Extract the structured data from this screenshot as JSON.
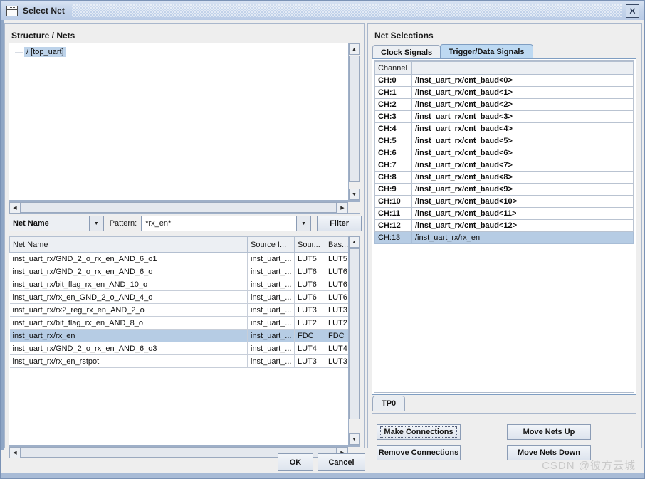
{
  "window": {
    "title": "Select Net",
    "icon": "window-icon",
    "close_label": "✕"
  },
  "left": {
    "header": "Structure / Nets",
    "tree": {
      "node_prefix": "—",
      "node_label": "/ [top_uart]"
    },
    "filter": {
      "field_select": "Net Name",
      "pattern_label": "Pattern:",
      "pattern_value": "*rx_en*",
      "filter_button": "Filter",
      "dropdown_icon": "chevron-down-icon"
    },
    "table": {
      "columns": [
        "Net Name",
        "Source I...",
        "Sour...",
        "Bas..."
      ],
      "rows": [
        {
          "net": "inst_uart_rx/GND_2_o_rx_en_AND_6_o1",
          "source_inst": "inst_uart_...",
          "source": "LUT5",
          "base": "LUT5",
          "selected": false
        },
        {
          "net": "inst_uart_rx/GND_2_o_rx_en_AND_6_o",
          "source_inst": "inst_uart_...",
          "source": "LUT6",
          "base": "LUT6",
          "selected": false
        },
        {
          "net": "inst_uart_rx/bit_flag_rx_en_AND_10_o",
          "source_inst": "inst_uart_...",
          "source": "LUT6",
          "base": "LUT6",
          "selected": false
        },
        {
          "net": "inst_uart_rx/rx_en_GND_2_o_AND_4_o",
          "source_inst": "inst_uart_...",
          "source": "LUT6",
          "base": "LUT6",
          "selected": false
        },
        {
          "net": "inst_uart_rx/rx2_reg_rx_en_AND_2_o",
          "source_inst": "inst_uart_...",
          "source": "LUT3",
          "base": "LUT3",
          "selected": false
        },
        {
          "net": "inst_uart_rx/bit_flag_rx_en_AND_8_o",
          "source_inst": "inst_uart_...",
          "source": "LUT2",
          "base": "LUT2",
          "selected": false
        },
        {
          "net": "inst_uart_rx/rx_en",
          "source_inst": "inst_uart_...",
          "source": "FDC",
          "base": "FDC",
          "selected": true
        },
        {
          "net": "inst_uart_rx/GND_2_o_rx_en_AND_6_o3",
          "source_inst": "inst_uart_...",
          "source": "LUT4",
          "base": "LUT4",
          "selected": false
        },
        {
          "net": "inst_uart_rx/rx_en_rstpot",
          "source_inst": "inst_uart_...",
          "source": "LUT3",
          "base": "LUT3",
          "selected": false
        }
      ]
    }
  },
  "right": {
    "header": "Net Selections",
    "tabs": [
      {
        "label": "Clock Signals",
        "active": false
      },
      {
        "label": "Trigger/Data Signals",
        "active": true
      }
    ],
    "channel_table": {
      "columns": [
        "Channel",
        ""
      ],
      "rows": [
        {
          "channel": "CH:0",
          "net": "/inst_uart_rx/cnt_baud<0>",
          "selected": false
        },
        {
          "channel": "CH:1",
          "net": "/inst_uart_rx/cnt_baud<1>",
          "selected": false
        },
        {
          "channel": "CH:2",
          "net": "/inst_uart_rx/cnt_baud<2>",
          "selected": false
        },
        {
          "channel": "CH:3",
          "net": "/inst_uart_rx/cnt_baud<3>",
          "selected": false
        },
        {
          "channel": "CH:4",
          "net": "/inst_uart_rx/cnt_baud<4>",
          "selected": false
        },
        {
          "channel": "CH:5",
          "net": "/inst_uart_rx/cnt_baud<5>",
          "selected": false
        },
        {
          "channel": "CH:6",
          "net": "/inst_uart_rx/cnt_baud<6>",
          "selected": false
        },
        {
          "channel": "CH:7",
          "net": "/inst_uart_rx/cnt_baud<7>",
          "selected": false
        },
        {
          "channel": "CH:8",
          "net": "/inst_uart_rx/cnt_baud<8>",
          "selected": false
        },
        {
          "channel": "CH:9",
          "net": "/inst_uart_rx/cnt_baud<9>",
          "selected": false
        },
        {
          "channel": "CH:10",
          "net": "/inst_uart_rx/cnt_baud<10>",
          "selected": false
        },
        {
          "channel": "CH:11",
          "net": "/inst_uart_rx/cnt_baud<11>",
          "selected": false
        },
        {
          "channel": "CH:12",
          "net": "/inst_uart_rx/cnt_baud<12>",
          "selected": false
        },
        {
          "channel": "CH:13",
          "net": "/inst_uart_rx/rx_en",
          "selected": true
        }
      ]
    },
    "unit_tabs": [
      {
        "label": "TP0",
        "active": true
      }
    ],
    "actions": {
      "make_connections": "Make Connections",
      "remove_connections": "Remove Connections",
      "move_nets_up": "Move Nets Up",
      "move_nets_down": "Move Nets Down"
    }
  },
  "footer": {
    "ok": "OK",
    "cancel": "Cancel",
    "watermark": "CSDN @彼方云城"
  },
  "colors": {
    "selection": "#b6cce4",
    "active_tab": "#bdd9f2",
    "titlebar": "#c3d3ea",
    "panel": "#eeeeee"
  }
}
